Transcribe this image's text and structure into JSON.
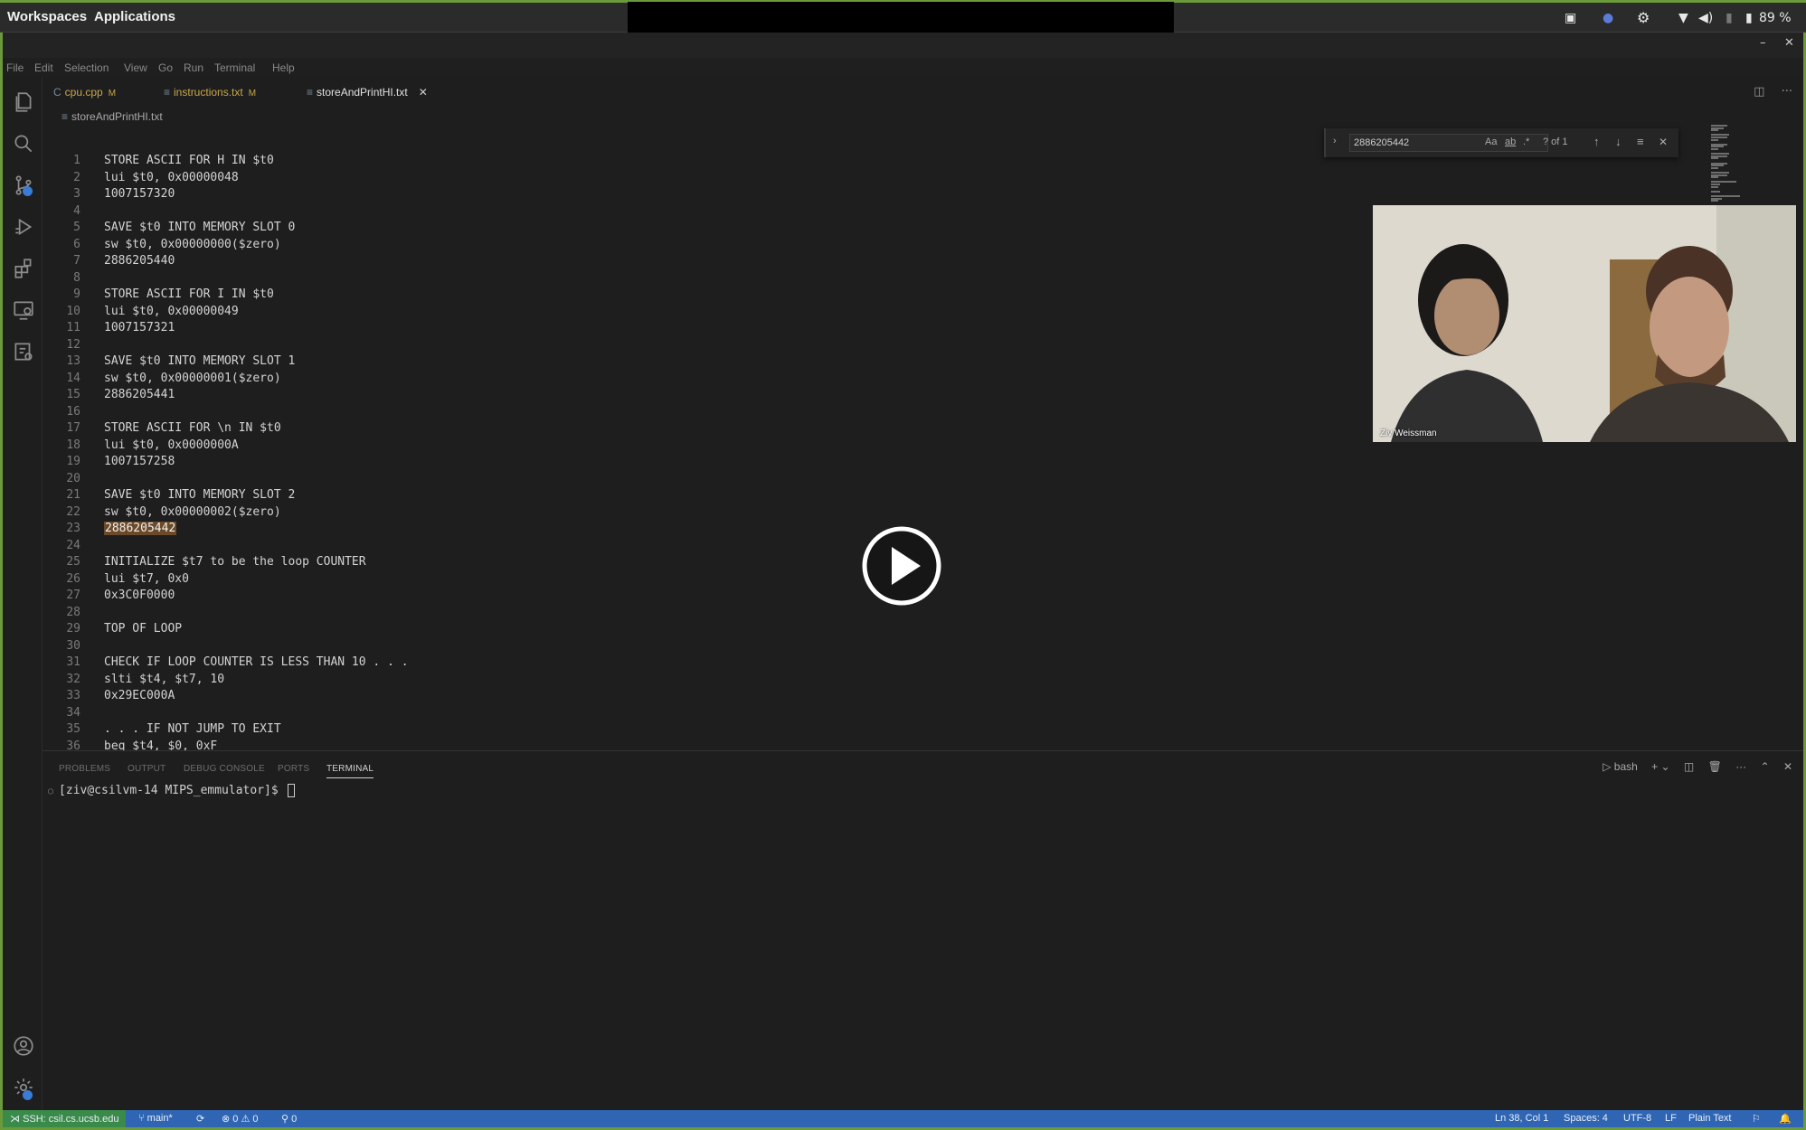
{
  "os": {
    "workspaces": "Workspaces",
    "applications": "Applications",
    "battery": "89 %"
  },
  "menubar": [
    "File",
    "Edit",
    "Selection",
    "View",
    "Go",
    "Run",
    "Terminal",
    "Help"
  ],
  "tabs": [
    {
      "label": "cpu.cpp",
      "mod": "M"
    },
    {
      "label": "instructions.txt",
      "mod": "M"
    },
    {
      "label": "storeAndPrintHI.txt"
    }
  ],
  "breadcrumb": "storeAndPrintHI.txt",
  "find": {
    "query": "2886205442",
    "case_label": "Aa",
    "result": "? of 1"
  },
  "editor_lines": [
    {
      "n": "1",
      "t": "STORE ASCII FOR H IN $t0"
    },
    {
      "n": "2",
      "t": "lui $t0, 0x00000048"
    },
    {
      "n": "3",
      "t": "1007157320"
    },
    {
      "n": "4",
      "t": ""
    },
    {
      "n": "5",
      "t": "SAVE $t0 INTO MEMORY SLOT 0"
    },
    {
      "n": "6",
      "t": "sw $t0, 0x00000000($zero)"
    },
    {
      "n": "7",
      "t": "2886205440"
    },
    {
      "n": "8",
      "t": ""
    },
    {
      "n": "9",
      "t": "STORE ASCII FOR I IN $t0"
    },
    {
      "n": "10",
      "t": "lui $t0, 0x00000049"
    },
    {
      "n": "11",
      "t": "1007157321"
    },
    {
      "n": "12",
      "t": ""
    },
    {
      "n": "13",
      "t": "SAVE $t0 INTO MEMORY SLOT 1"
    },
    {
      "n": "14",
      "t": "sw $t0, 0x00000001($zero)"
    },
    {
      "n": "15",
      "t": "2886205441"
    },
    {
      "n": "16",
      "t": ""
    },
    {
      "n": "17",
      "t": "STORE ASCII FOR \\n IN $t0"
    },
    {
      "n": "18",
      "t": "lui $t0, 0x0000000A"
    },
    {
      "n": "19",
      "t": "1007157258"
    },
    {
      "n": "20",
      "t": ""
    },
    {
      "n": "21",
      "t": "SAVE $t0 INTO MEMORY SLOT 2"
    },
    {
      "n": "22",
      "t": "sw $t0, 0x00000002($zero)"
    },
    {
      "n": "23",
      "t": "2886205442",
      "highlight": true
    },
    {
      "n": "24",
      "t": ""
    },
    {
      "n": "25",
      "t": "INITIALIZE $t7 to be the loop COUNTER"
    },
    {
      "n": "26",
      "t": "lui $t7, 0x0"
    },
    {
      "n": "27",
      "t": "0x3C0F0000"
    },
    {
      "n": "28",
      "t": ""
    },
    {
      "n": "29",
      "t": "TOP OF LOOP"
    },
    {
      "n": "30",
      "t": ""
    },
    {
      "n": "31",
      "t": "CHECK IF LOOP COUNTER IS LESS THAN 10 . . ."
    },
    {
      "n": "32",
      "t": "slti $t4, $t7, 10"
    },
    {
      "n": "33",
      "t": "0x29EC000A"
    },
    {
      "n": "34",
      "t": ""
    },
    {
      "n": "35",
      "t": ". . . IF NOT JUMP TO EXIT"
    },
    {
      "n": "36",
      "t": "beq $t4, $0, 0xF"
    }
  ],
  "video": {
    "name": "Ziv Weissman"
  },
  "panel": {
    "tabs": [
      "PROBLEMS",
      "OUTPUT",
      "DEBUG CONSOLE",
      "PORTS",
      "TERMINAL"
    ],
    "shell": "bash",
    "prompt": "[ziv@csilvm-14 MIPS_emmulator]$ "
  },
  "status": {
    "remote": "SSH: csil.cs.ucsb.edu",
    "branch": "main*",
    "errors": "0",
    "warnings": "0",
    "ports": "0",
    "position": "Ln 38, Col 1",
    "spaces": "Spaces: 4",
    "encoding": "UTF-8",
    "eol": "LF",
    "language": "Plain Text"
  }
}
